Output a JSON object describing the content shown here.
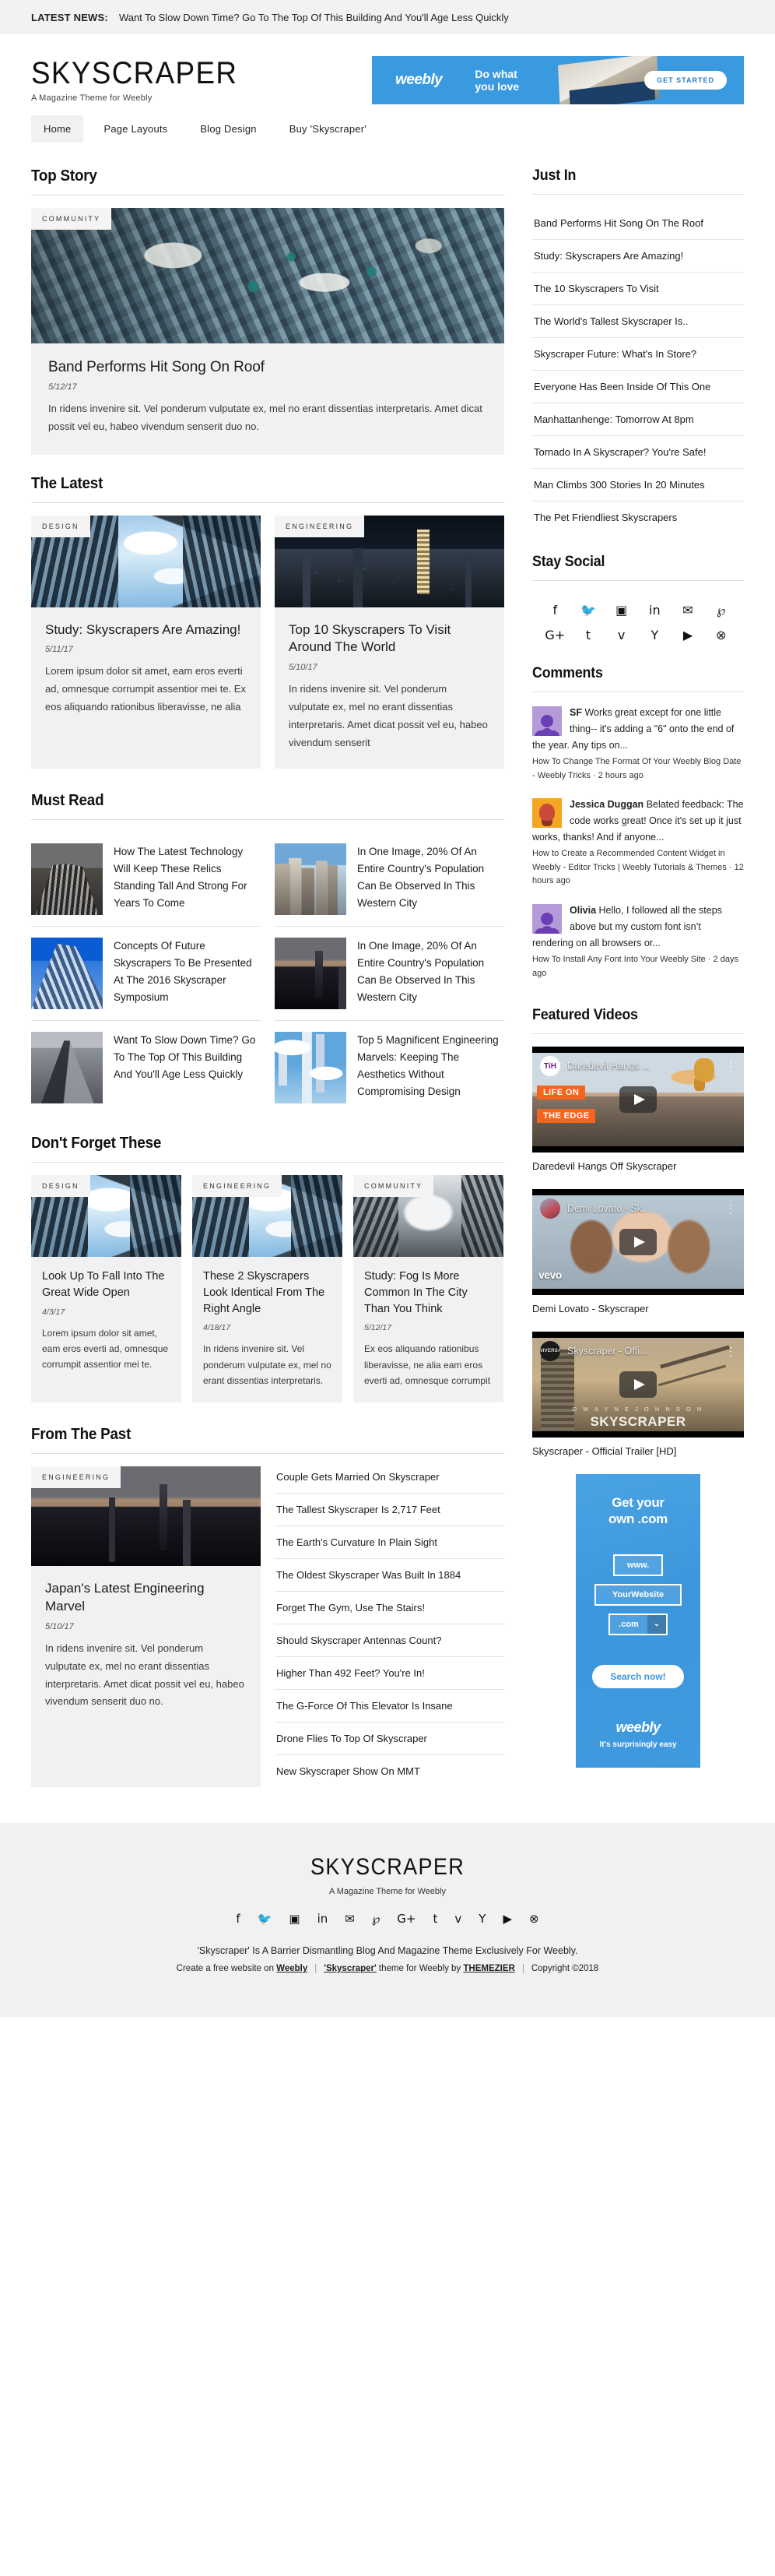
{
  "ticker": {
    "label": "LATEST NEWS:",
    "text": "Want To Slow Down Time? Go To The Top Of This Building And You'll Age Less Quickly"
  },
  "header": {
    "brand": "SKYSCRAPER",
    "tagline": "A Magazine Theme for Weebly",
    "ad": {
      "logo": "weebly",
      "line1": "Do what",
      "line2": "you love",
      "cta": "GET STARTED"
    }
  },
  "nav": {
    "items": [
      {
        "label": "Home",
        "active": true
      },
      {
        "label": "Page Layouts",
        "active": false
      },
      {
        "label": "Blog Design",
        "active": false
      },
      {
        "label": "Buy 'Skyscraper'",
        "active": false
      }
    ]
  },
  "top_story": {
    "heading": "Top Story",
    "category": "COMMUNITY",
    "title": "Band Performs Hit Song On Roof",
    "date": "5/12/17",
    "excerpt": "In ridens invenire sit. Vel ponderum vulputate ex, mel no erant dissentias interpretaris. Amet dicat possit vel eu, habeo vivendum senserit duo no."
  },
  "the_latest": {
    "heading": "The Latest",
    "cards": [
      {
        "category": "DESIGN",
        "title": "Study: Skyscrapers Are Amazing!",
        "date": "5/11/17",
        "excerpt": "Lorem ipsum dolor sit amet, eam eros everti ad, omnesque corrumpit assentior mei te. Ex eos aliquando rationibus liberavisse, ne alia"
      },
      {
        "category": "ENGINEERING",
        "title": "Top 10 Skyscrapers To Visit Around The World",
        "date": "5/10/17",
        "excerpt": "In ridens invenire sit. Vel ponderum vulputate ex, mel no erant dissentias interpretaris. Amet dicat possit vel eu, habeo vivendum senserit"
      }
    ]
  },
  "must_read": {
    "heading": "Must Read",
    "items": [
      {
        "title": "How The Latest Technology Will Keep These Relics Standing Tall And Strong For Years To Come"
      },
      {
        "title": "In One Image, 20% Of An Entire Country's Population Can Be Observed In This Western City"
      },
      {
        "title": "Concepts Of Future Skyscrapers To Be Presented At The 2016 Skyscraper Symposium"
      },
      {
        "title": "In One Image, 20% Of An Entire Country's Population Can Be Observed In This Western City"
      },
      {
        "title": "Want To Slow Down Time? Go To The Top Of This Building And You'll Age Less Quickly"
      },
      {
        "title": "Top 5 Magnificent Engineering Marvels: Keeping The Aesthetics Without Compromising Design"
      }
    ]
  },
  "dont_forget": {
    "heading": "Don't Forget These",
    "cards": [
      {
        "category": "DESIGN",
        "title": "Look Up To Fall Into The Great Wide Open",
        "date": "4/3/17",
        "excerpt": "Lorem ipsum dolor sit amet, eam eros everti ad, omnesque corrumpit assentior mei te."
      },
      {
        "category": "ENGINEERING",
        "title": "These 2 Skyscrapers Look Identical From The Right Angle",
        "date": "4/18/17",
        "excerpt": "In ridens invenire sit. Vel ponderum vulputate ex, mel no erant dissentias interpretaris."
      },
      {
        "category": "COMMUNITY",
        "title": "Study: Fog Is More Common In The City Than You Think",
        "date": "5/12/17",
        "excerpt": "Ex eos aliquando rationibus liberavisse, ne alia eam eros everti ad, omnesque corrumpit"
      }
    ]
  },
  "from_the_past": {
    "heading": "From The Past",
    "feature": {
      "category": "ENGINEERING",
      "title": "Japan's Latest Engineering Marvel",
      "date": "5/10/17",
      "excerpt": "In ridens invenire sit. Vel ponderum vulputate ex, mel no erant dissentias interpretaris. Amet dicat possit vel eu, habeo vivendum senserit duo no."
    },
    "links": [
      "Couple Gets Married On Skyscraper",
      "The Tallest Skyscraper Is 2,717 Feet",
      "The Earth's Curvature In Plain Sight",
      "The Oldest Skyscraper Was Built In 1884",
      "Forget The Gym, Use The Stairs!",
      "Should Skyscraper Antennas Count?",
      "Higher Than 492 Feet? You're In!",
      "The G-Force Of This Elevator Is Insane",
      "Drone Flies To Top Of Skyscraper",
      "New Skyscraper Show On MMT"
    ]
  },
  "sidebar": {
    "just_in": {
      "heading": "Just In",
      "items": [
        "Band Performs Hit Song On The Roof",
        "Study: Skyscrapers Are Amazing!",
        "The 10 Skyscrapers To Visit",
        "The World's Tallest Skyscraper Is..",
        "Skyscraper Future: What's In Store?",
        "Everyone Has Been Inside Of This One",
        "Manhattanhenge: Tomorrow At 8pm",
        "Tornado In A Skyscraper? You're Safe!",
        "Man Climbs 300 Stories In 20 Minutes",
        "The Pet Friendliest Skyscrapers"
      ]
    },
    "stay_social": {
      "heading": "Stay Social",
      "icons": [
        {
          "name": "facebook-icon",
          "glyph": "f"
        },
        {
          "name": "twitter-icon",
          "glyph": "🐦"
        },
        {
          "name": "instagram-icon",
          "glyph": "▣"
        },
        {
          "name": "linkedin-icon",
          "glyph": "in"
        },
        {
          "name": "email-icon",
          "glyph": "✉"
        },
        {
          "name": "pinterest-icon",
          "glyph": "℘"
        },
        {
          "name": "googleplus-icon",
          "glyph": "G+"
        },
        {
          "name": "tumblr-icon",
          "glyph": "t"
        },
        {
          "name": "vimeo-icon",
          "glyph": "v"
        },
        {
          "name": "yahoo-icon",
          "glyph": "Y"
        },
        {
          "name": "youtube-icon",
          "glyph": "▶"
        },
        {
          "name": "dribbble-icon",
          "glyph": "⊗"
        }
      ]
    },
    "comments": {
      "heading": "Comments",
      "items": [
        {
          "author": "SF",
          "text": " Works great except for one little thing-- it's adding a \"6\" onto the end of the year. Any tips on...",
          "meta": "How To Change The Format Of Your Weebly Blog Date - Weebly Tricks · 2 hours ago",
          "avatar": "purple"
        },
        {
          "author": "Jessica Duggan",
          "text": " Belated feedback: The code works great! Once it's set up it just works, thanks! And if anyone...",
          "meta": "How to Create a Recommended Content Widget in Weebly - Editor Tricks | Weebly Tutorials & Themes · 12 hours ago",
          "avatar": "orange"
        },
        {
          "author": "Olivia",
          "text": " Hello, I followed all the steps above but my custom font isn’t rendering on all browsers or...",
          "meta": "How To Install Any Font Into Your Weebly Site · 2 days ago",
          "avatar": "purple"
        }
      ]
    },
    "featured_videos": {
      "heading": "Featured Videos",
      "items": [
        {
          "chrome_title": "Daredevil Hangs ...",
          "badge": "TiH",
          "caption": "Daredevil Hangs Off Skyscraper",
          "overlay1": "LIFE ON",
          "overlay2": "THE EDGE"
        },
        {
          "chrome_title": "Demi Lovato - Sk...",
          "badge": "",
          "caption": "Demi Lovato - Skyscraper",
          "overlay1": "vevo",
          "overlay2": ""
        },
        {
          "chrome_title": "Skyscraper - Offi...",
          "badge": "UNIVERSAL",
          "caption": "Skyscraper - Official Trailer [HD]",
          "overlay1": "D W A Y N E   J O H N S O N",
          "overlay2": "SKYSCRAPER"
        }
      ]
    },
    "domain_ad": {
      "heading_line1": "Get your",
      "heading_line2": "own .com",
      "field_www": "www.",
      "field_site": "YourWebsite",
      "field_tld": ".com",
      "button": "Search now!",
      "logo": "weebly",
      "tagline": "It's surprisingly easy"
    }
  },
  "footer": {
    "brand": "SKYSCRAPER",
    "tagline": "A Magazine Theme for Weebly",
    "icons": [
      {
        "name": "facebook-icon",
        "glyph": "f"
      },
      {
        "name": "twitter-icon",
        "glyph": "🐦"
      },
      {
        "name": "instagram-icon",
        "glyph": "▣"
      },
      {
        "name": "linkedin-icon",
        "glyph": "in"
      },
      {
        "name": "email-icon",
        "glyph": "✉"
      },
      {
        "name": "pinterest-icon",
        "glyph": "℘"
      },
      {
        "name": "googleplus-icon",
        "glyph": "G+"
      },
      {
        "name": "tumblr-icon",
        "glyph": "t"
      },
      {
        "name": "vimeo-icon",
        "glyph": "v"
      },
      {
        "name": "yahoo-icon",
        "glyph": "Y"
      },
      {
        "name": "youtube-icon",
        "glyph": "▶"
      },
      {
        "name": "dribbble-icon",
        "glyph": "⊗"
      }
    ],
    "description": "'Skyscraper' Is A Barrier Dismantling Blog And Magazine Theme Exclusively For Weebly.",
    "legal": {
      "create_pre": "Create a free website on ",
      "create_link": "Weebly",
      "theme_link": "'Skyscraper'",
      "theme_mid": " theme for Weebly by ",
      "theme_author": "THEMEZIER",
      "copyright": "Copyright ©2018"
    }
  }
}
